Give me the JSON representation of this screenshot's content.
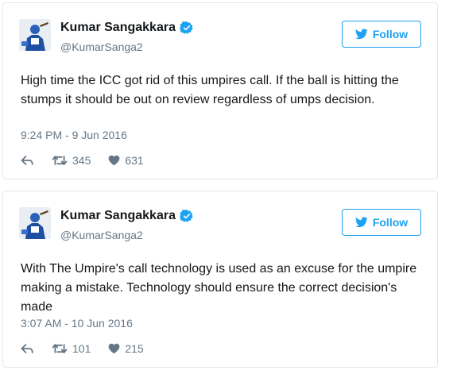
{
  "colors": {
    "accent": "#1da1f2",
    "muted": "#657786",
    "text": "#14171a",
    "border": "#e1e8ed"
  },
  "tweets": [
    {
      "author_name": "Kumar Sangakkara",
      "handle": "@KumarSanga2",
      "follow_label": "Follow",
      "text": "High time the ICC got rid of this umpires call. If the ball is hitting the stumps it should be out on review regardless of umps decision.",
      "timestamp": "9:24 PM - 9 Jun 2016",
      "retweets": "345",
      "likes": "631",
      "icons": [
        "verified-badge-icon",
        "twitter-bird-icon",
        "reply-icon",
        "retweet-icon",
        "heart-icon"
      ]
    },
    {
      "author_name": "Kumar Sangakkara",
      "handle": "@KumarSanga2",
      "follow_label": "Follow",
      "text": "With The Umpire's call technology is used as an excuse for the umpire making a mistake. Technology should ensure the correct decision's made",
      "timestamp": "3:07 AM - 10 Jun 2016",
      "retweets": "101",
      "likes": "215",
      "icons": [
        "verified-badge-icon",
        "twitter-bird-icon",
        "reply-icon",
        "retweet-icon",
        "heart-icon"
      ]
    }
  ]
}
